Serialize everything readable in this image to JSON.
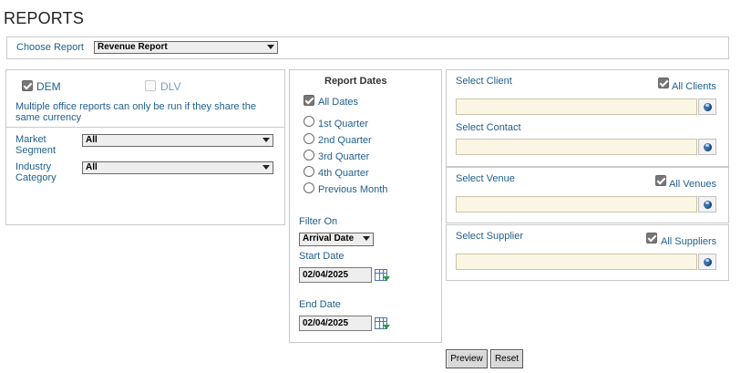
{
  "page": {
    "title": "REPORTS"
  },
  "choose_report": {
    "label": "Choose Report",
    "selected": "Revenue Report"
  },
  "offices": {
    "dem": {
      "label": "DEM",
      "checked": true
    },
    "dlv": {
      "label": "DLV",
      "checked": false
    },
    "note": "Multiple office reports can only be run if they share the same currency"
  },
  "segment": {
    "market_label": "Market Segment",
    "market_value": "All",
    "industry_label": "Industry Category",
    "industry_value": "All"
  },
  "dates": {
    "heading": "Report Dates",
    "all_dates_label": "All Dates",
    "options": [
      "1st Quarter",
      "2nd Quarter",
      "3rd Quarter",
      "4th Quarter",
      "Previous Month"
    ],
    "filter_label": "Filter On",
    "filter_value": "Arrival Date",
    "start_label": "Start Date",
    "start_value": "02/04/2025",
    "end_label": "End Date",
    "end_value": "02/04/2025"
  },
  "client": {
    "select_client": "Select Client",
    "all_clients": "All Clients",
    "select_contact": "Select Contact"
  },
  "venue": {
    "select_venue": "Select Venue",
    "all_venues": "All Venues"
  },
  "supplier": {
    "select_supplier": "Select Supplier",
    "all_suppliers": "All Suppliers"
  },
  "actions": {
    "preview": "Preview",
    "reset": "Reset"
  },
  "colors": {
    "label_blue": "#1f5f8b",
    "field_bg": "#fbf6e3",
    "button_bg": "#d9d9d9"
  }
}
